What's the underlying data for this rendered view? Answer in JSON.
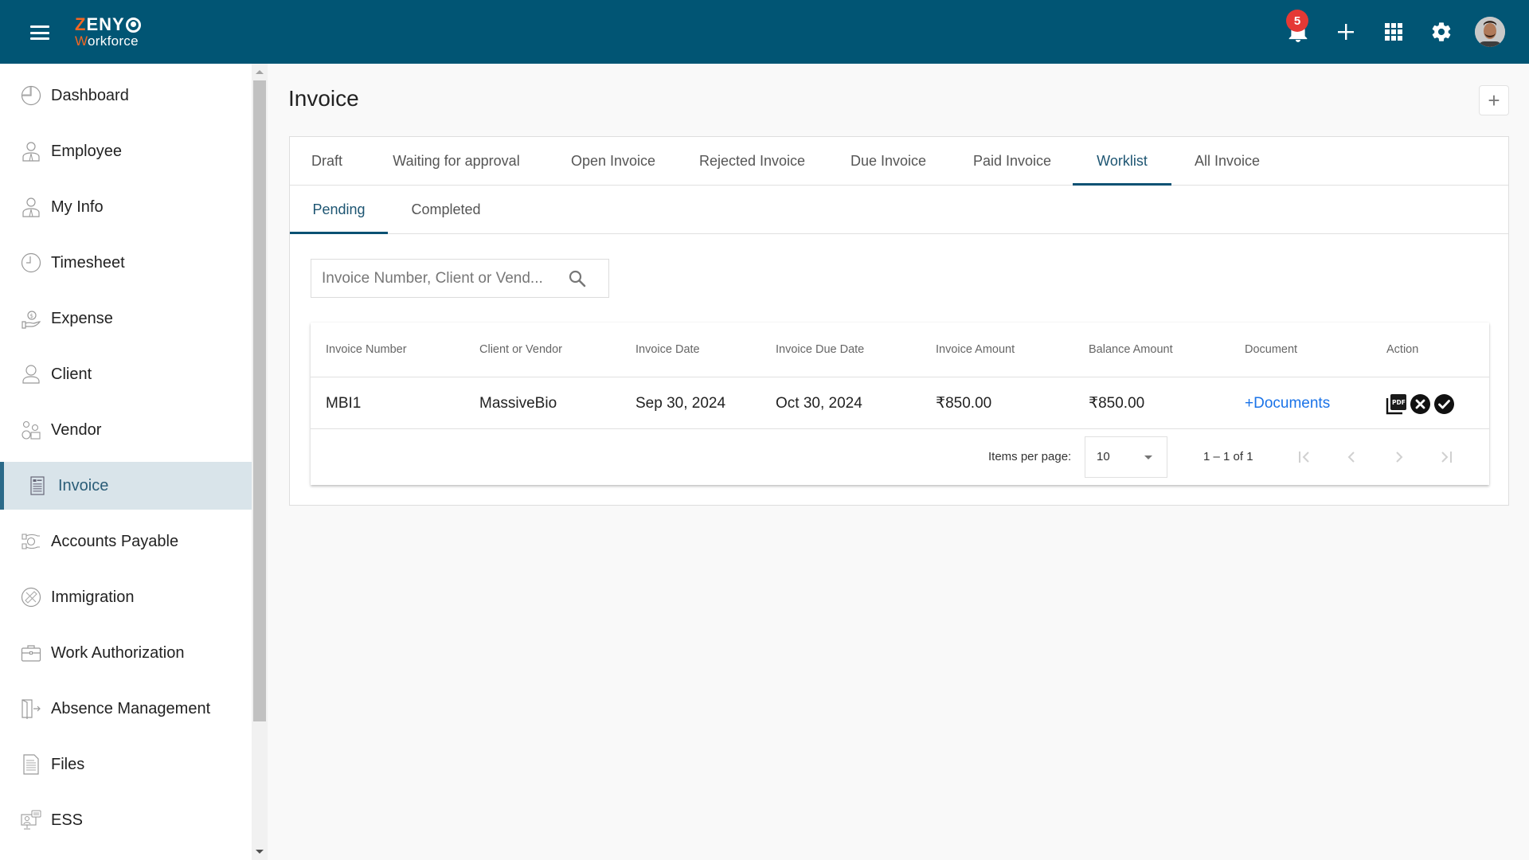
{
  "header": {
    "logo_line1_first": "Z",
    "logo_line1_rest": "ENY",
    "logo_line2_first": "W",
    "logo_line2_rest": "orkforce",
    "notification_count": "5",
    "brand_color": "#015574",
    "accent_color": "#f26722"
  },
  "sidebar": {
    "items": [
      {
        "label": "Dashboard",
        "icon": "pie-chart-icon"
      },
      {
        "label": "Employee",
        "icon": "employee-icon"
      },
      {
        "label": "My Info",
        "icon": "user-info-icon"
      },
      {
        "label": "Timesheet",
        "icon": "clock-icon"
      },
      {
        "label": "Expense",
        "icon": "money-hand-icon"
      },
      {
        "label": "Client",
        "icon": "person-icon"
      },
      {
        "label": "Vendor",
        "icon": "vendor-icon"
      },
      {
        "label": "Invoice",
        "icon": "invoice-icon",
        "active": true
      },
      {
        "label": "Accounts Payable",
        "icon": "hands-money-icon"
      },
      {
        "label": "Immigration",
        "icon": "plane-icon"
      },
      {
        "label": "Work Authorization",
        "icon": "briefcase-icon"
      },
      {
        "label": "Absence Management",
        "icon": "exit-door-icon"
      },
      {
        "label": "Files",
        "icon": "file-icon"
      },
      {
        "label": "ESS",
        "icon": "self-service-icon"
      }
    ]
  },
  "page": {
    "title": "Invoice",
    "add_label": "+"
  },
  "tabs": [
    {
      "label": "Draft"
    },
    {
      "label": "Waiting for approval"
    },
    {
      "label": "Open Invoice"
    },
    {
      "label": "Rejected Invoice"
    },
    {
      "label": "Due Invoice"
    },
    {
      "label": "Paid Invoice"
    },
    {
      "label": "Worklist",
      "active": true
    },
    {
      "label": "All Invoice"
    }
  ],
  "subtabs": [
    {
      "label": "Pending",
      "active": true
    },
    {
      "label": "Completed"
    }
  ],
  "search": {
    "placeholder": "Invoice Number, Client or Vend...",
    "value": ""
  },
  "table": {
    "columns": [
      "Invoice Number",
      "Client or Vendor",
      "Invoice Date",
      "Invoice Due Date",
      "Invoice Amount",
      "Balance Amount",
      "Document",
      "Action"
    ],
    "rows": [
      {
        "invoice_number": "MBI1",
        "client_or_vendor": "MassiveBio",
        "invoice_date": "Sep 30, 2024",
        "invoice_due_date": "Oct 30, 2024",
        "invoice_amount": "₹850.00",
        "balance_amount": "₹850.00",
        "document": "+Documents",
        "actions": [
          "pdf-icon",
          "reject-icon",
          "approve-icon"
        ]
      }
    ]
  },
  "paginator": {
    "items_per_page_label": "Items per page:",
    "items_per_page": "10",
    "range": "1 – 1 of 1"
  }
}
